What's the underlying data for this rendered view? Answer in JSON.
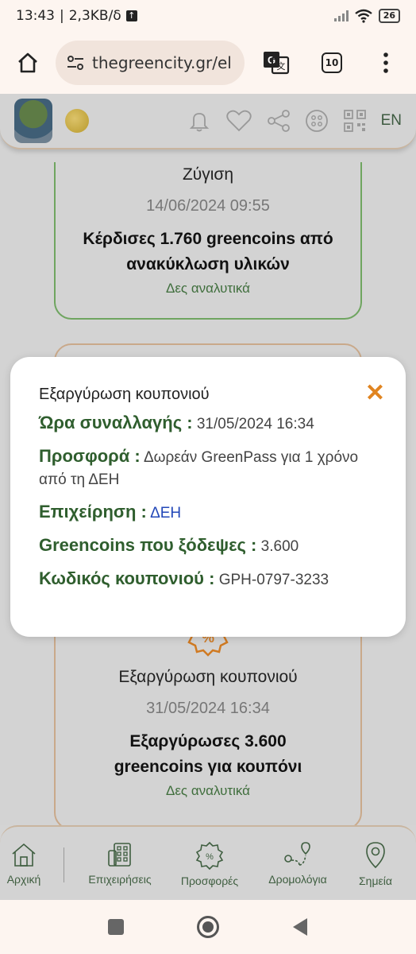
{
  "status_bar": {
    "time": "13:43",
    "speed": "2,3KB/δ",
    "battery": "26"
  },
  "browser": {
    "url": "thegreencity.gr/el",
    "tab_count": "10"
  },
  "header": {
    "language": "EN"
  },
  "cards": [
    {
      "title": "Ζύγιση",
      "date": "14/06/2024 09:55",
      "description": "Κέρδισες 1.760 greencoins από ανακύκλωση υλικών",
      "link": "Δες αναλυτικά",
      "color": "#6fa560"
    },
    {
      "title": "Εξαργύρωση κουπονιού",
      "date": "31/05/2024 16:34",
      "description": "Εξαργύρωσες 3.600 greencoins για κουπόνι",
      "link": "Δες αναλυτικά",
      "color": "#c9a98a"
    }
  ],
  "modal": {
    "title": "Εξαργύρωση κουπονιού",
    "close_icon": "close-icon",
    "rows": [
      {
        "label": "Ώρα συναλλαγής :",
        "value": "31/05/2024 16:34"
      },
      {
        "label": "Προσφορά :",
        "value": "Δωρεάν GreenPass για 1 χρόνο από τη ΔΕΗ"
      },
      {
        "label": "Επιχείρηση :",
        "value": "ΔΕΗ"
      },
      {
        "label": "Greencoins που ξόδεψες :",
        "value": "3.600"
      },
      {
        "label": "Κωδικός κουπονιού :",
        "value": "GPH-0797-3233"
      }
    ]
  },
  "bottom_nav": [
    {
      "label": "Αρχική",
      "icon": "home-icon"
    },
    {
      "label": "Επιχειρήσεις",
      "icon": "building-icon"
    },
    {
      "label": "Προσφορές",
      "icon": "discount-badge-icon"
    },
    {
      "label": "Δρομολόγια",
      "icon": "route-icon"
    },
    {
      "label": "Σημεία",
      "icon": "location-pin-icon"
    }
  ],
  "colors": {
    "accent_green": "#2f5e2e",
    "close_orange": "#e08420",
    "link_blue": "#2348b8"
  }
}
